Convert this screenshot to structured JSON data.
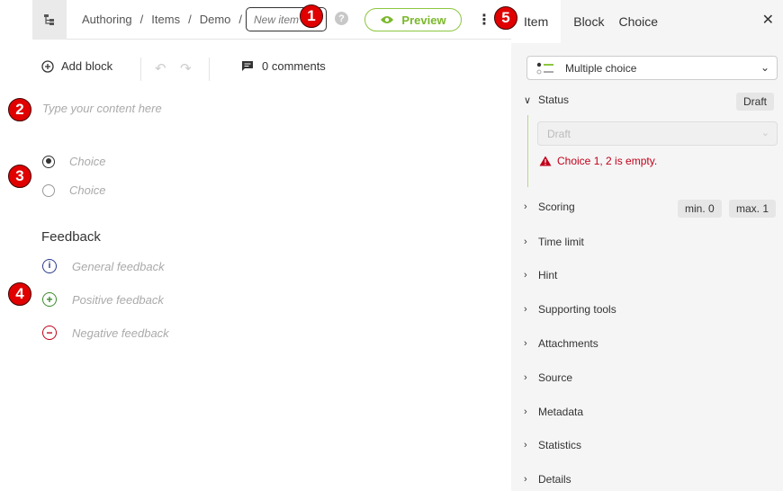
{
  "breadcrumb": [
    "Authoring",
    "Items",
    "Demo"
  ],
  "title_input": {
    "placeholder": "New item"
  },
  "help_glyph": "?",
  "preview_label": "Preview",
  "toolbar": {
    "add_block": "Add block",
    "comments": "0 comments"
  },
  "content_placeholder": "Type your content here",
  "choices": [
    {
      "label": "Choice",
      "selected": true
    },
    {
      "label": "Choice",
      "selected": false
    }
  ],
  "feedback": {
    "title": "Feedback",
    "general": "General feedback",
    "positive": "Positive feedback",
    "negative": "Negative feedback"
  },
  "badges": [
    "1",
    "2",
    "3",
    "4",
    "5"
  ],
  "panel": {
    "tabs": [
      "Item",
      "Block",
      "Choice"
    ],
    "active_tab": "Item",
    "interaction_type": "Multiple choice",
    "status": {
      "label": "Status",
      "value": "Draft",
      "select_value": "Draft",
      "error": "Choice 1, 2 is empty."
    },
    "scoring": {
      "label": "Scoring",
      "min": "min. 0",
      "max": "max. 1"
    },
    "sections": [
      "Time limit",
      "Hint",
      "Supporting tools",
      "Attachments",
      "Source",
      "Metadata",
      "Statistics",
      "Details"
    ]
  },
  "colors": {
    "accent_green": "#8cc63f",
    "error_red": "#c0001a",
    "badge_red": "#e00000"
  }
}
